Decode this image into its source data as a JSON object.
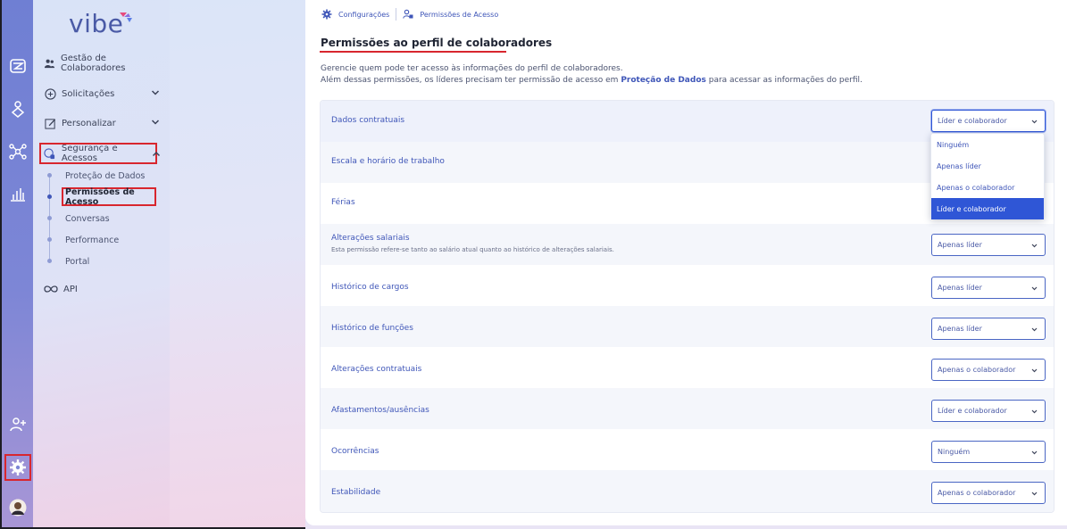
{
  "breadcrumb": {
    "items": [
      "Configurações",
      "Permissões de Acesso"
    ]
  },
  "page": {
    "title": "Permissões ao perfil de colaboradores",
    "desc_line1": "Gerencie quem pode ter acesso às informações do perfil de colaboradores.",
    "desc_line2_before": "Além dessas permissões, os líderes precisam ter permissão de acesso em ",
    "desc_link": "Proteção de Dados",
    "desc_line2_after": " para acessar as informações do perfil."
  },
  "sidebar": {
    "logo": "vibe",
    "items": [
      {
        "label": "Gestão de Colaboradores"
      },
      {
        "label": "Solicitações"
      },
      {
        "label": "Personalizar"
      },
      {
        "label": "Segurança e Acessos"
      }
    ],
    "subitems": [
      "Proteção de Dados",
      "Permissões de Acesso",
      "Conversas",
      "Performance",
      "Portal"
    ],
    "api_label": "API"
  },
  "rows": [
    {
      "label": "Dados contratuais",
      "value": "Líder e colaborador",
      "note": ""
    },
    {
      "label": "Escala e horário de trabalho",
      "value": "",
      "note": ""
    },
    {
      "label": "Férias",
      "value": "",
      "note": ""
    },
    {
      "label": "Alterações salariais",
      "value": "Apenas líder",
      "note": "Esta permissão refere-se tanto ao salário atual quanto ao histórico de alterações salariais."
    },
    {
      "label": "Histórico de cargos",
      "value": "Apenas líder",
      "note": ""
    },
    {
      "label": "Histórico de funções",
      "value": "Apenas líder",
      "note": ""
    },
    {
      "label": "Alterações contratuais",
      "value": "Apenas o colaborador",
      "note": ""
    },
    {
      "label": "Afastamentos/ausências",
      "value": "Líder e colaborador",
      "note": ""
    },
    {
      "label": "Ocorrências",
      "value": "Ninguém",
      "note": ""
    },
    {
      "label": "Estabilidade",
      "value": "Apenas o colaborador",
      "note": ""
    }
  ],
  "dropdown": {
    "options": [
      "Ninguém",
      "Apenas líder",
      "Apenas o colaborador",
      "Líder e colaborador"
    ],
    "selected": "Líder e colaborador"
  },
  "colors": {
    "accent": "#3f56b8",
    "highlight": "#d8262e",
    "selected": "#2f56d6"
  },
  "icons": [
    "inbox-icon",
    "people-heart-icon",
    "network-icon",
    "bar-chart-icon",
    "add-user-icon",
    "gear-icon",
    "avatar",
    "settings-icon",
    "user-lock-icon",
    "team-icon",
    "plus-circle-icon",
    "edit-icon",
    "security-icon",
    "infinity-icon",
    "chevron-down-icon"
  ]
}
